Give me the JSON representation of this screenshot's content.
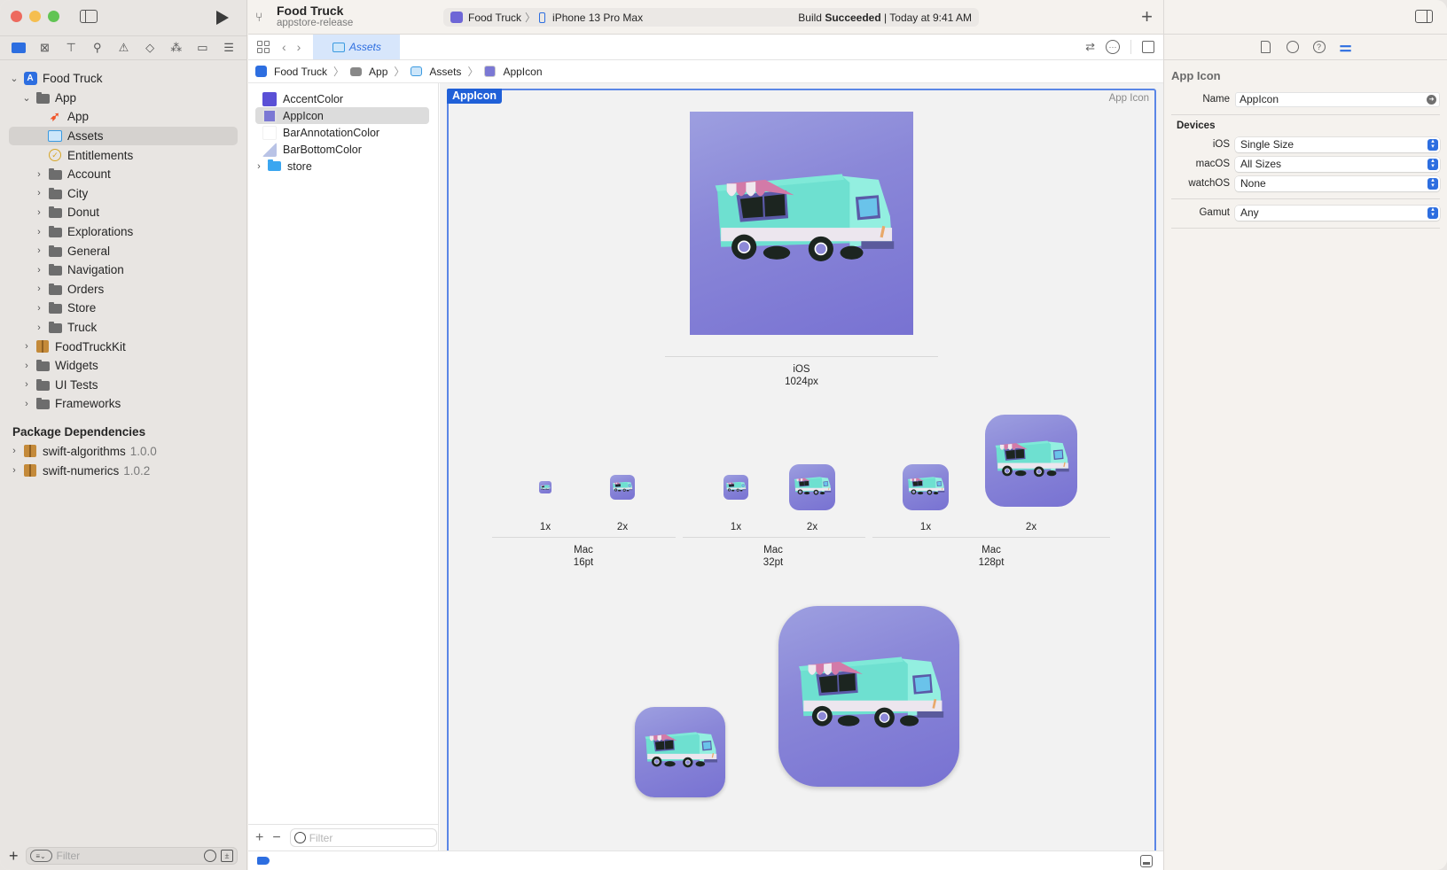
{
  "window": {
    "project_title": "Food Truck",
    "branch": "appstore-release"
  },
  "scheme": {
    "target": "Food Truck",
    "device": "iPhone 13 Pro Max",
    "status_prefix": "Build",
    "status_bold": "Succeeded",
    "status_suffix": "| Today at 9:41 AM"
  },
  "navigator": {
    "tabs": [
      "project-navigator",
      "source-control",
      "symbols",
      "find",
      "issues",
      "tests",
      "debug",
      "breakpoints",
      "reports"
    ],
    "tree": [
      {
        "label": "Food Truck",
        "icon": "project-icon",
        "level": 0,
        "expanded": true
      },
      {
        "label": "App",
        "icon": "folder-icon",
        "level": 1,
        "expanded": true
      },
      {
        "label": "App",
        "icon": "swift-icon",
        "level": 2
      },
      {
        "label": "Assets",
        "icon": "asset-catalog-icon",
        "level": 2,
        "selected": true
      },
      {
        "label": "Entitlements",
        "icon": "entitlements-icon",
        "level": 2
      },
      {
        "label": "Account",
        "icon": "folder-icon",
        "level": 2,
        "collapsed": true
      },
      {
        "label": "City",
        "icon": "folder-icon",
        "level": 2,
        "collapsed": true
      },
      {
        "label": "Donut",
        "icon": "folder-icon",
        "level": 2,
        "collapsed": true
      },
      {
        "label": "Explorations",
        "icon": "folder-icon",
        "level": 2,
        "collapsed": true
      },
      {
        "label": "General",
        "icon": "folder-icon",
        "level": 2,
        "collapsed": true
      },
      {
        "label": "Navigation",
        "icon": "folder-icon",
        "level": 2,
        "collapsed": true
      },
      {
        "label": "Orders",
        "icon": "folder-icon",
        "level": 2,
        "collapsed": true
      },
      {
        "label": "Store",
        "icon": "folder-icon",
        "level": 2,
        "collapsed": true
      },
      {
        "label": "Truck",
        "icon": "folder-icon",
        "level": 2,
        "collapsed": true
      },
      {
        "label": "FoodTruckKit",
        "icon": "package-icon",
        "level": 1,
        "collapsed": true
      },
      {
        "label": "Widgets",
        "icon": "folder-icon",
        "level": 1,
        "collapsed": true
      },
      {
        "label": "UI Tests",
        "icon": "folder-icon",
        "level": 1,
        "collapsed": true
      },
      {
        "label": "Frameworks",
        "icon": "folder-icon",
        "level": 1,
        "collapsed": true
      }
    ],
    "package_header": "Package Dependencies",
    "packages": [
      {
        "label": "swift-algorithms",
        "version": "1.0.0"
      },
      {
        "label": "swift-numerics",
        "version": "1.0.2"
      }
    ],
    "filter_placeholder": "Filter"
  },
  "editor": {
    "tab_label": "Assets",
    "jumpbar": [
      "Food Truck",
      "App",
      "Assets",
      "AppIcon"
    ],
    "asset_list": [
      {
        "label": "AccentColor",
        "swatch": "#5a50d6"
      },
      {
        "label": "AppIcon",
        "swatch": "appicon",
        "selected": true
      },
      {
        "label": "BarAnnotationColor",
        "swatch": "#ffffff"
      },
      {
        "label": "BarBottomColor",
        "swatch": "split"
      },
      {
        "label": "store",
        "swatch": "folder"
      }
    ],
    "asset_filter_placeholder": "Filter",
    "set_name": "AppIcon",
    "set_kind": "App Icon",
    "slots": {
      "ios": {
        "platform": "iOS",
        "size": "1024px"
      },
      "mac16": {
        "platform": "Mac",
        "size": "16pt",
        "scales": [
          "1x",
          "2x"
        ]
      },
      "mac32": {
        "platform": "Mac",
        "size": "32pt",
        "scales": [
          "1x",
          "2x"
        ]
      },
      "mac128": {
        "platform": "Mac",
        "size": "128pt",
        "scales": [
          "1x",
          "2x"
        ]
      }
    }
  },
  "inspector": {
    "section_title": "App Icon",
    "name_label": "Name",
    "name_value": "AppIcon",
    "devices_header": "Devices",
    "rows": [
      {
        "label": "iOS",
        "value": "Single Size"
      },
      {
        "label": "macOS",
        "value": "All Sizes"
      },
      {
        "label": "watchOS",
        "value": "None"
      }
    ],
    "gamut_label": "Gamut",
    "gamut_value": "Any"
  },
  "colors": {
    "accent": "#2d6ee0",
    "icon_bg": "#8a87d8",
    "truck_body": "#6ee0d0"
  }
}
